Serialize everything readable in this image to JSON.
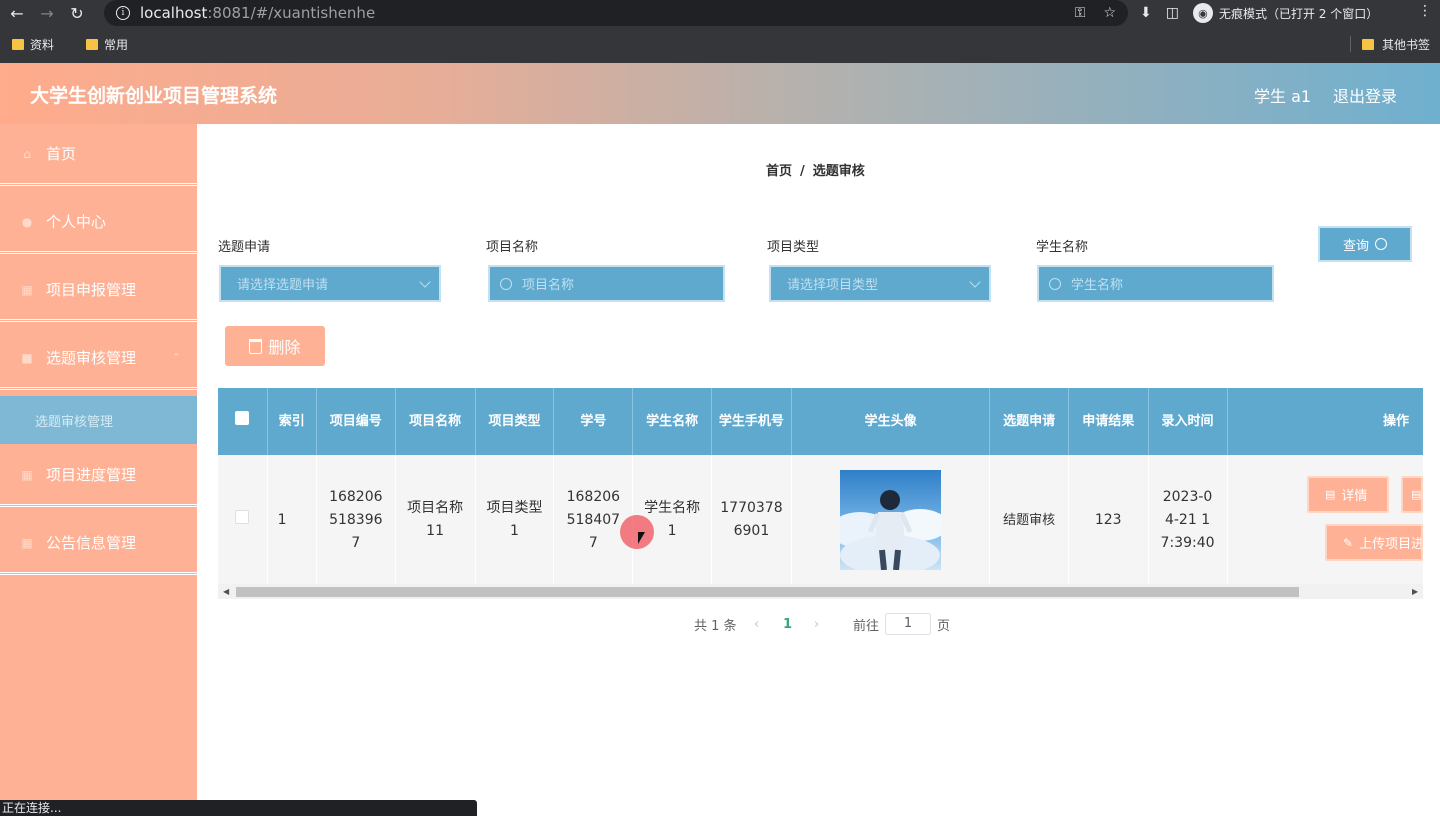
{
  "browser": {
    "url_host": "localhost",
    "url_rest": ":8081/#/xuantishenhe",
    "incognito_label": "无痕模式（已打开 2 个窗口）",
    "bookmarks": [
      "资料",
      "常用"
    ],
    "other_bookmarks": "其他书签",
    "status_text": "正在连接..."
  },
  "header": {
    "title": "大学生创新创业项目管理系统",
    "user": "学生 a1",
    "logout": "退出登录"
  },
  "sidebar": {
    "items": [
      {
        "label": "首页"
      },
      {
        "label": "个人中心"
      },
      {
        "label": "项目申报管理"
      },
      {
        "label": "选题审核管理"
      },
      {
        "label": "项目进度管理"
      },
      {
        "label": "公告信息管理"
      }
    ],
    "sub_item": "选题审核管理"
  },
  "breadcrumb": {
    "home": "首页",
    "separator": "/",
    "current": "选题审核"
  },
  "filters": {
    "f1_label": "选题申请",
    "f1_placeholder": "请选择选题申请",
    "f2_label": "项目名称",
    "f2_placeholder": "项目名称",
    "f3_label": "项目类型",
    "f3_placeholder": "请选择项目类型",
    "f4_label": "学生名称",
    "f4_placeholder": "学生名称",
    "query_label": "查询"
  },
  "actions": {
    "delete_label": "删除"
  },
  "table": {
    "headers": [
      "索引",
      "项目编号",
      "项目名称",
      "项目类型",
      "学号",
      "学生名称",
      "学生手机号",
      "学生头像",
      "选题申请",
      "申请结果",
      "录入时间",
      "操作"
    ],
    "rows": [
      {
        "index": "1",
        "project_no": "1682065183967",
        "project_name": "项目名称11",
        "project_type": "项目类型1",
        "student_no": "1682065184077",
        "student_name": "学生名称1",
        "phone": "17703786901",
        "apply": "结题审核",
        "result": "123",
        "time": "2023-04-21 17:39:40",
        "detail_label": "详情",
        "upload_label": "上传项目进"
      }
    ]
  },
  "pagination": {
    "total": "共 1 条",
    "current_page": "1",
    "goto_label": "前往",
    "goto_value": "1",
    "page_suffix": "页"
  },
  "colors": {
    "accent_blue": "#5fa9cf",
    "accent_salmon": "#ffb195"
  }
}
